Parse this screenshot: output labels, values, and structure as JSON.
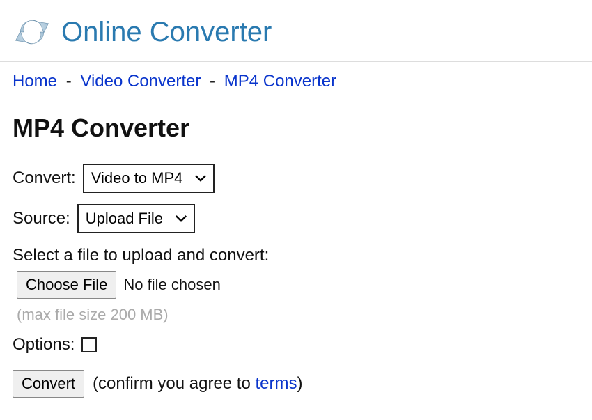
{
  "header": {
    "site_title": "Online Converter"
  },
  "breadcrumb": {
    "items": [
      "Home",
      "Video Converter",
      "MP4 Converter"
    ],
    "separator": "-"
  },
  "page": {
    "title": "MP4 Converter"
  },
  "form": {
    "convert_label": "Convert:",
    "convert_value": "Video to MP4",
    "source_label": "Source:",
    "source_value": "Upload File",
    "select_instruction": "Select a file to upload and convert:",
    "choose_file_button": "Choose File",
    "file_status": "No file chosen",
    "max_size_hint": "(max file size 200 MB)",
    "options_label": "Options:",
    "convert_button": "Convert",
    "confirm_prefix": "(confirm you agree to ",
    "terms_link": "terms",
    "confirm_suffix": ")"
  }
}
